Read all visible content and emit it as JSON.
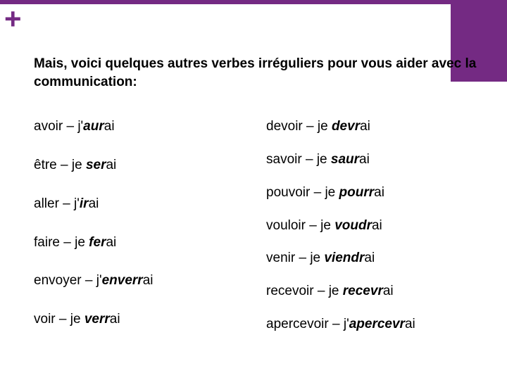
{
  "plus_symbol": "+",
  "heading": "Mais, voici quelques autres verbes irréguliers pour vous aider avec la communication:",
  "left_column": [
    {
      "infinitive": "avoir",
      "prefix": "j'",
      "stem": "aur",
      "ending": "ai"
    },
    {
      "infinitive": "être",
      "prefix": "je ",
      "stem": "ser",
      "ending": "ai"
    },
    {
      "infinitive": "aller",
      "prefix": "j'",
      "stem": "ir",
      "ending": "ai"
    },
    {
      "infinitive": "faire",
      "prefix": "je ",
      "stem": "fer",
      "ending": "ai"
    },
    {
      "infinitive": "envoyer",
      "prefix": "j'",
      "stem": "enverr",
      "ending": "ai"
    },
    {
      "infinitive": "voir",
      "prefix": "je ",
      "stem": "verr",
      "ending": "ai"
    }
  ],
  "right_column": [
    {
      "infinitive": "devoir",
      "prefix": "je ",
      "stem": "devr",
      "ending": "ai"
    },
    {
      "infinitive": "savoir",
      "prefix": "je ",
      "stem": "saur",
      "ending": "ai"
    },
    {
      "infinitive": "pouvoir",
      "prefix": "je ",
      "stem": "pourr",
      "ending": "ai"
    },
    {
      "infinitive": "vouloir",
      "prefix": "je ",
      "stem": "voudr",
      "ending": "ai"
    },
    {
      "infinitive": "venir",
      "prefix": "je ",
      "stem": "viendr",
      "ending": "ai"
    },
    {
      "infinitive": "recevoir",
      "prefix": "je ",
      "stem": "recevr",
      "ending": "ai"
    },
    {
      "infinitive": "apercevoir",
      "prefix": "j'",
      "stem": "apercevr",
      "ending": "ai"
    }
  ]
}
